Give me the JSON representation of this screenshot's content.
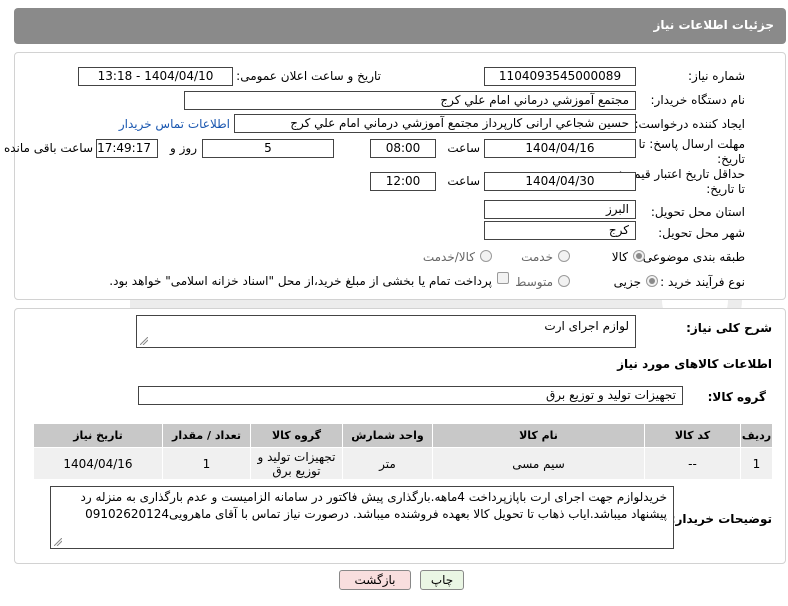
{
  "header": {
    "title": "جزئیات اطلاعات نیاز"
  },
  "form": {
    "need_number_label": "شماره نیاز:",
    "need_number": "1104093545000089",
    "announce_label": "تاریخ و ساعت اعلان عمومی:",
    "announce_value": "1404/04/10 - 13:18",
    "buyer_org_label": "نام دستگاه خریدار:",
    "buyer_org": "مجتمع آموزشي درماني امام علي كرج",
    "creator_label": "ایجاد کننده درخواست:",
    "creator": "حسين شجاعي ارانی کارپرداز مجتمع آموزشي درماني امام علي كرج",
    "buyer_contact_link": "اطلاعات تماس خریدار",
    "reply_deadline_label_1": "مهلت ارسال پاسخ: تا",
    "reply_deadline_label_2": "تاریخ:",
    "reply_date": "1404/04/16",
    "time_label": "ساعت",
    "reply_time": "08:00",
    "days_value": "5",
    "days_label": "روز و",
    "remaining_time": "17:49:17",
    "remaining_label": "ساعت باقی مانده",
    "price_validity_label_1": "حداقل تاریخ اعتبار قیمت:",
    "price_validity_label_2": "تا تاریخ:",
    "price_date": "1404/04/30",
    "price_time": "12:00",
    "province_label": "استان محل تحویل:",
    "province": "البرز",
    "city_label": "شهر محل تحویل:",
    "city": "كرج",
    "category_label": "طبقه بندی موضوعی:",
    "category_options": [
      "کالا",
      "خدمت",
      "کالا/خدمت"
    ],
    "process_label": "نوع فرآیند خرید :",
    "process_options": [
      "جزیی",
      "متوسط"
    ],
    "payment_note": "پرداخت تمام یا بخشی از مبلغ خرید،از محل \"اسناد خزانه اسلامی\" خواهد بود."
  },
  "details": {
    "summary_label": "شرح کلی نیاز:",
    "summary": "لوازم اجرای ارت",
    "goods_info_title": "اطلاعات کالاهای مورد نیاز",
    "goods_group_label": "گروه کالا:",
    "goods_group": "تجهیزات تولید و توزیع برق",
    "table": {
      "headers": [
        "ردیف",
        "کد کالا",
        "نام کالا",
        "واحد شمارش",
        "گروه کالا",
        "تعداد / مقدار",
        "تاریخ نیاز"
      ],
      "rows": [
        [
          "1",
          "--",
          "سیم مسی",
          "متر",
          "تجهیزات تولید و توزیع برق",
          "1",
          "1404/04/16"
        ]
      ]
    },
    "buyer_notes_label": "توضیحات خریدار:",
    "buyer_notes": "خریدلوازم جهت اجرای ارت باپازپرداخت 4ماهه.بارگذاری پیش فاکتور در سامانه الزامیست و عدم بارگذاری به منزله رد پیشنهاد میباشد.ایاب ذهاب تا تحویل کالا بعهده فروشنده میباشد. درصورت نیاز تماس با آقای ماهرویی09102620124"
  },
  "buttons": {
    "print": "چاپ",
    "back": "بازگشت"
  },
  "colors": {
    "header_bg": "#8a8a8a",
    "link": "#1a57b0",
    "print_bg": "#eaf6e4",
    "back_bg": "#f8dede"
  }
}
